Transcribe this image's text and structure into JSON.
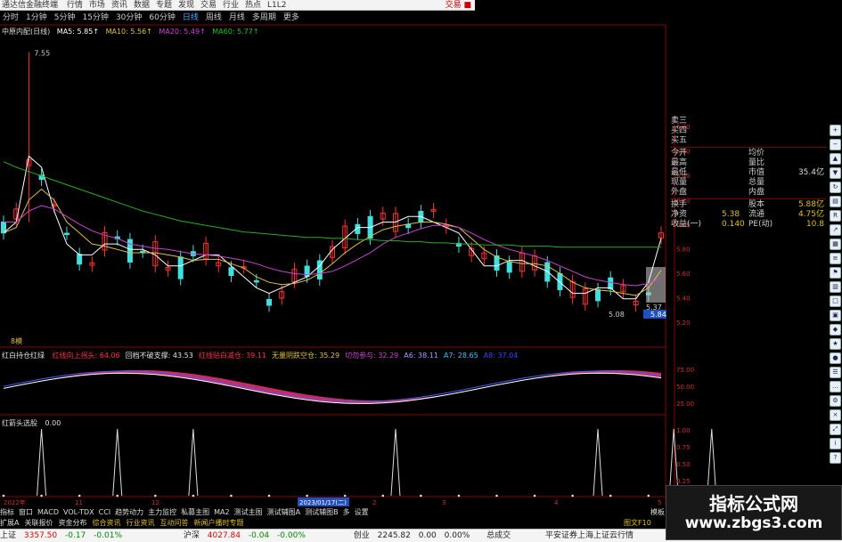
{
  "app": {
    "title": "通达信金融终端",
    "menu": [
      "行情",
      "市场",
      "资讯",
      "数据",
      "专题",
      "发现",
      "交易",
      "行业",
      "热点",
      "L1L2"
    ],
    "trade_label": "交易 ■"
  },
  "periods": {
    "items": [
      "分时",
      "1分钟",
      "5分钟",
      "15分钟",
      "30分钟",
      "60分钟",
      "日线",
      "周线",
      "月线",
      "多周期",
      "更多"
    ],
    "active": "日线"
  },
  "main_chart": {
    "legend": {
      "name": "中原内配(日线)",
      "ma5": "MA5: 5.85↑",
      "ma10": "MA10: 5.56↑",
      "ma20": "MA20: 5.49↑",
      "ma60": "MA60: 5.77↑"
    },
    "high_marker": "7.55",
    "low_marker": "5.08",
    "last_marker": "5.37",
    "current_price_tag": "5.84",
    "lower_left_tag": "8模",
    "price_axis": [
      "6.80",
      "6.60",
      "6.40",
      "6.20",
      "6.00",
      "5.80",
      "5.60",
      "5.40",
      "5.20"
    ],
    "colors": {
      "ma5": "#ffffff",
      "ma10": "#e0c040",
      "ma20": "#d040d0",
      "ma60": "#20b020",
      "up": "#ff3030",
      "down": "#40e0e0"
    }
  },
  "chart_data": [
    {
      "type": "line",
      "title": "中原内配(日线)",
      "ylim": [
        4.9,
        7.7
      ],
      "series": [
        {
          "name": "MA5",
          "values": [
            5.9,
            6.0,
            6.6,
            6.5,
            6.1,
            5.8,
            5.7,
            5.7,
            5.8,
            5.8,
            5.75,
            5.75,
            5.7,
            5.6,
            5.6,
            5.65,
            5.7,
            5.7,
            5.6,
            5.5,
            5.4,
            5.35,
            5.4,
            5.45,
            5.5,
            5.6,
            5.75,
            5.85,
            5.95,
            5.95,
            6.0,
            6.0,
            6.05,
            6.05,
            6.0,
            5.95,
            5.9,
            5.75,
            5.6,
            5.6,
            5.65,
            5.65,
            5.6,
            5.55,
            5.45,
            5.35,
            5.35,
            5.4,
            5.4,
            5.3,
            5.3,
            5.45,
            5.85
          ]
        },
        {
          "name": "MA10",
          "values": [
            5.9,
            5.95,
            6.2,
            6.3,
            6.2,
            6.0,
            5.9,
            5.8,
            5.78,
            5.75,
            5.72,
            5.72,
            5.72,
            5.7,
            5.68,
            5.65,
            5.66,
            5.66,
            5.62,
            5.58,
            5.5,
            5.45,
            5.43,
            5.44,
            5.47,
            5.53,
            5.62,
            5.72,
            5.8,
            5.87,
            5.93,
            5.96,
            5.98,
            6.0,
            6.0,
            5.98,
            5.95,
            5.85,
            5.75,
            5.68,
            5.64,
            5.62,
            5.62,
            5.6,
            5.53,
            5.45,
            5.4,
            5.38,
            5.37,
            5.35,
            5.33,
            5.4,
            5.56
          ]
        },
        {
          "name": "MA20",
          "values": [
            6.0,
            6.0,
            6.1,
            6.15,
            6.12,
            6.05,
            5.98,
            5.92,
            5.88,
            5.85,
            5.8,
            5.78,
            5.76,
            5.75,
            5.73,
            5.71,
            5.7,
            5.69,
            5.67,
            5.65,
            5.62,
            5.58,
            5.55,
            5.53,
            5.52,
            5.53,
            5.55,
            5.6,
            5.66,
            5.72,
            5.8,
            5.86,
            5.9,
            5.94,
            5.97,
            5.97,
            5.95,
            5.9,
            5.84,
            5.79,
            5.75,
            5.72,
            5.69,
            5.65,
            5.6,
            5.55,
            5.5,
            5.47,
            5.45,
            5.43,
            5.42,
            5.44,
            5.49
          ]
        },
        {
          "name": "MA60",
          "values": [
            6.55,
            6.5,
            6.46,
            6.42,
            6.38,
            6.34,
            6.3,
            6.26,
            6.22,
            6.18,
            6.14,
            6.1,
            6.07,
            6.04,
            6.01,
            5.99,
            5.97,
            5.95,
            5.93,
            5.91,
            5.9,
            5.89,
            5.88,
            5.87,
            5.86,
            5.86,
            5.85,
            5.85,
            5.84,
            5.84,
            5.83,
            5.83,
            5.82,
            5.82,
            5.81,
            5.81,
            5.8,
            5.8,
            5.79,
            5.79,
            5.79,
            5.78,
            5.78,
            5.78,
            5.77,
            5.77,
            5.77,
            5.77,
            5.77,
            5.77,
            5.77,
            5.77,
            5.77
          ]
        }
      ]
    },
    {
      "type": "area",
      "title": "红白持仓红绿",
      "ylim": [
        0,
        100
      ],
      "y_ticks": [
        "75.00",
        "50.00",
        "25.00"
      ]
    },
    {
      "type": "bar",
      "title": "红箭头选股",
      "ylim": [
        0,
        1
      ],
      "y_ticks": [
        "1.00",
        "0.75",
        "0.50",
        "0.25"
      ],
      "spikes_at": [
        3,
        9,
        15,
        31,
        47,
        53,
        56
      ]
    }
  ],
  "indicator1": {
    "name": "红白持仓红绿",
    "labels": [
      "红线向上拐头: 64.06",
      "回档不破支撑: 43.53",
      "红线贴白减仓: 39.11",
      "无量阴跌空仓: 35.29",
      "切勿参与: 32.29",
      "A6: 38.11",
      "A7: 28.65",
      "A8: 37.04"
    ]
  },
  "indicator2": {
    "name": "红箭头选股",
    "value": "0.00"
  },
  "time_axis": {
    "labels": [
      "2022年",
      "11",
      "12",
      "2023/01/17(二)",
      "2",
      "3",
      "4",
      "5"
    ]
  },
  "quote": {
    "ask3": "卖三",
    "bid4": "买四",
    "bid5": "买五",
    "open": "今开",
    "avg": "均价",
    "high": "最高",
    "vol_ratio": "量比",
    "low": "最低",
    "mkt_value_label": "市值",
    "mkt_value": "35.4亿",
    "cur_vol": "现量",
    "total_vol": "总量",
    "outer": "外盘",
    "inner": "内盘",
    "turnover_label": "换手",
    "shares_label": "股本",
    "shares": "5.88亿",
    "nav_label": "净资",
    "nav": "5.38",
    "float_label": "流通",
    "float": "4.75亿",
    "eps_label": "收益(一)",
    "eps": "0.140",
    "pe_label": "PE(动)",
    "pe": "10.8"
  },
  "tabs": {
    "row1": [
      "指标",
      "窗口",
      "MACD",
      "VOL-TDX",
      "CCI",
      "趋势动力",
      "主力监控",
      "私募主图",
      "MA2",
      "测试主图",
      "测试辅图A",
      "测试辅图B",
      "多",
      "设置"
    ],
    "row1_right": "模板",
    "row2": [
      "扩展A",
      "关联报价",
      "资金分布",
      "综合资讯",
      "行业资讯",
      "互动问答",
      "新闻户播时专题"
    ],
    "row2_right": "图文F10"
  },
  "status": {
    "items": [
      {
        "label": "上证",
        "v1": "3357.50",
        "v2": "-0.17",
        "v3": "-0.01%"
      },
      {
        "label": "沪深",
        "v1": "4027.84",
        "v2": "-0.04",
        "v3": "-0.00%"
      },
      {
        "label": "创业",
        "v1": "2245.82",
        "v2": "0.00",
        "v3": "0.00%"
      }
    ],
    "total_label": "总成交",
    "broker": "平安证券上海上证云行情"
  },
  "watermark": {
    "line1": "指标公式网",
    "line2": "www.zbgs3.com"
  }
}
